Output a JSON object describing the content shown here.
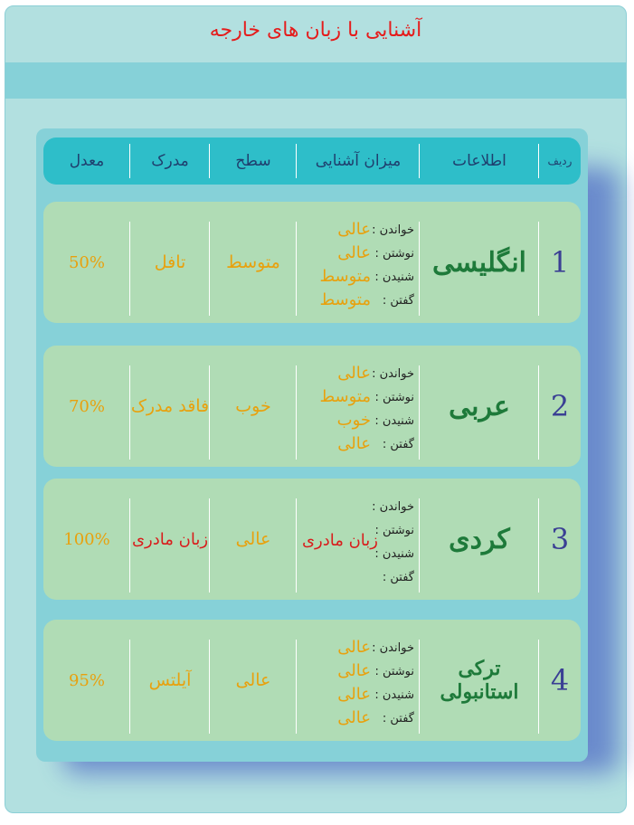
{
  "page_title": "آشنایی با زبان های خارجه",
  "table": {
    "headers": {
      "row": "ردیف",
      "info": "اطلاعات",
      "familiarity": "میزان آشنایی",
      "level": "سطح",
      "certificate": "مدرک",
      "average": "معدل"
    },
    "skill_labels": [
      "خواندن :",
      "نوشتن :",
      "شنیدن :",
      "گفتن :"
    ],
    "rows": [
      {
        "num": "1",
        "language": "انگلیسی",
        "skills": [
          "عالی",
          "عالی",
          "متوسط",
          "متوسط"
        ],
        "level": "متوسط",
        "certificate": "تافل",
        "average": "50%"
      },
      {
        "num": "2",
        "language": "عربی",
        "skills": [
          "عالی",
          "متوسط",
          "خوب",
          "عالی"
        ],
        "level": "خوب",
        "certificate": "فاقد مدرک",
        "average": "70%"
      },
      {
        "num": "3",
        "language": "کردی",
        "skills_combined": "زبان مادری",
        "level": "عالی",
        "certificate": "زبان مادری",
        "average": "100%"
      },
      {
        "num": "4",
        "language": "ترکی استانبولی",
        "skills": [
          "عالی",
          "عالی",
          "عالی",
          "عالی"
        ],
        "level": "عالی",
        "certificate": "آیلتس",
        "average": "95%"
      }
    ]
  },
  "colors": {
    "title": "#e51c1c",
    "frame": "#b2e0e0",
    "band": "#86d1d8",
    "header": "#2ebec9",
    "row": "#b0dcb5",
    "value": "#e8a10e",
    "language": "#1e7a3a",
    "number": "#3a3f94",
    "shadow": "#5e7cc9"
  }
}
